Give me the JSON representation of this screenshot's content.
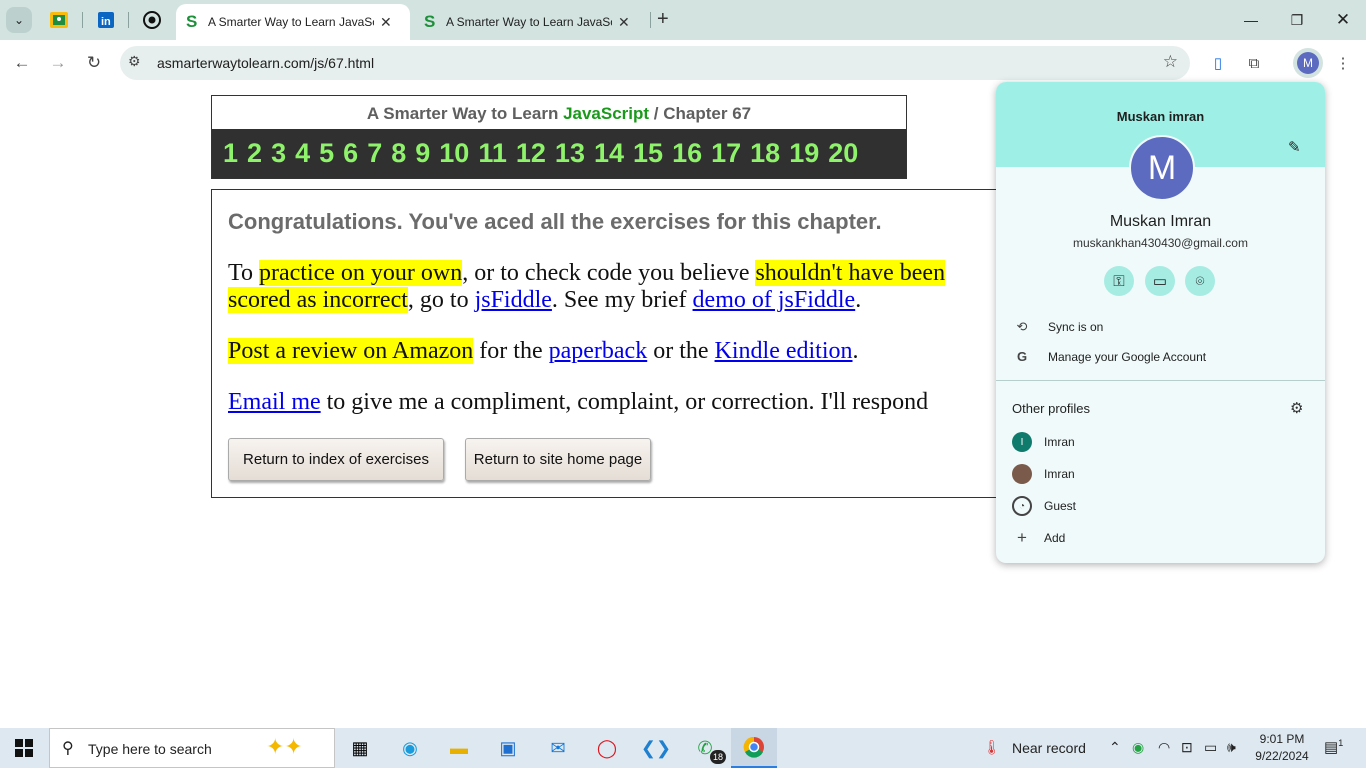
{
  "browser": {
    "tabs": [
      {
        "title": "A Smarter Way to Learn JavaScr",
        "favicon": "S",
        "active": true
      },
      {
        "title": "A Smarter Way to Learn JavaScr",
        "favicon": "S",
        "active": false
      }
    ],
    "new_tab": "+",
    "url": "asmarterwaytolearn.com/js/67.html",
    "profile_initial": "M"
  },
  "page": {
    "header": {
      "prefix": "A Smarter Way to Learn ",
      "brand": "JavaScript",
      "separator": " / ",
      "chapter": "Chapter 67"
    },
    "chapters": [
      "1",
      "2",
      "3",
      "4",
      "5",
      "6",
      "7",
      "8",
      "9",
      "10",
      "11",
      "12",
      "13",
      "14",
      "15",
      "16",
      "17",
      "18",
      "19",
      "20"
    ],
    "congrats": "Congratulations. You've aced all the exercises for this chapter.",
    "para1": {
      "t1": "To ",
      "h1": "practice on your own",
      "t2": ", or to check code you believe ",
      "h2a": "shouldn't have been",
      "h2b": "scored as incorrect",
      "t3": ", go to ",
      "l1": "jsFiddle",
      "t4": ". See my brief ",
      "l2": "demo of jsFiddle",
      "t5": "."
    },
    "para2": {
      "h1": "Post a review on Amazon",
      "t1": " for the ",
      "l1": "paperback",
      "t2": " or the ",
      "l2": "Kindle edition",
      "t3": "."
    },
    "para3": {
      "l1": "Email me",
      "t1": " to give me a compliment, complaint, or correction. I'll respond"
    },
    "buttons": {
      "index": "Return to index of exercises",
      "home": "Return to site home page"
    }
  },
  "profile_menu": {
    "header_name": "Muskan imran",
    "avatar_initial": "M",
    "full_name": "Muskan Imran",
    "email": "muskankhan430430@gmail.com",
    "sync": "Sync is on",
    "manage": "Manage your Google Account",
    "other_profiles_title": "Other profiles",
    "profiles": [
      {
        "name": "Imran",
        "initial": "I"
      },
      {
        "name": "Imran",
        "initial": ""
      },
      {
        "name": "Guest",
        "initial": ""
      }
    ],
    "add": "Add"
  },
  "taskbar": {
    "search_placeholder": "Type here to search",
    "whatsapp_badge": "18",
    "weather": "Near record",
    "time": "9:01 PM",
    "date": "9/22/2024",
    "notifications": "1"
  },
  "colors": {
    "tabstrip": "#d3e3e0",
    "brand_green": "#1a9a1a",
    "chapter_green": "#8ef36a",
    "highlight": "#ffff00",
    "link": "#0000ee",
    "popup_header": "#9ef0e6"
  }
}
